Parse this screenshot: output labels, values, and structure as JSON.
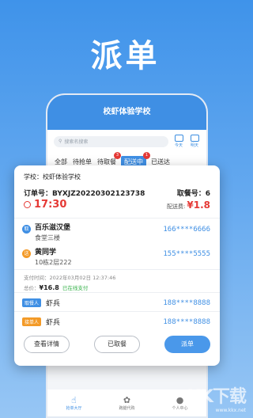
{
  "hero_title": "派单",
  "phone": {
    "title": "校虾体验学校",
    "search_placeholder": "搜索名搜索",
    "cal_today": "今天",
    "cal_tomorrow": "明天",
    "tabs": [
      {
        "label": "全部",
        "badge": ""
      },
      {
        "label": "待抢单",
        "badge": ""
      },
      {
        "label": "待取餐",
        "badge": "3"
      },
      {
        "label": "配送中",
        "badge": "1",
        "active": true
      },
      {
        "label": "已送达",
        "badge": ""
      }
    ],
    "nav": [
      {
        "label": "抢单大厅",
        "icon": "hand"
      },
      {
        "label": "跑腿代购",
        "icon": "runner"
      },
      {
        "label": "个人中心",
        "icon": "person"
      }
    ]
  },
  "card": {
    "school_label": "学校：校虾体验学校",
    "order_label": "订单号：",
    "order_no": "BYXJZ20220302123738",
    "meal_label": "取餐号：",
    "meal_no": "6",
    "time": "17:30",
    "fee_label": "配送费:",
    "fee": "¥1.8",
    "pickup": {
      "pin": "取",
      "name": "百乐滋汉堡",
      "addr": "食堂三楼",
      "phone": "166****6666"
    },
    "delivery": {
      "pin": "送",
      "name": "黄同学",
      "addr": "10栋2层222",
      "phone": "155****5555"
    },
    "pay_time": "支付时间：2022年03月02日 12:37:46",
    "total_label": "总价：",
    "total": "¥16.8",
    "paid": "已在线支付",
    "taker": {
      "tag": "取餐人",
      "name": "虾兵",
      "phone": "188****8888"
    },
    "sender": {
      "tag": "接单人",
      "name": "虾兵",
      "phone": "188****8888"
    },
    "btn_detail": "查看详情",
    "btn_picked": "已取餐",
    "btn_dispatch": "派单"
  },
  "watermark": {
    "logo": "KK下载",
    "url": "www.kkx.net"
  }
}
